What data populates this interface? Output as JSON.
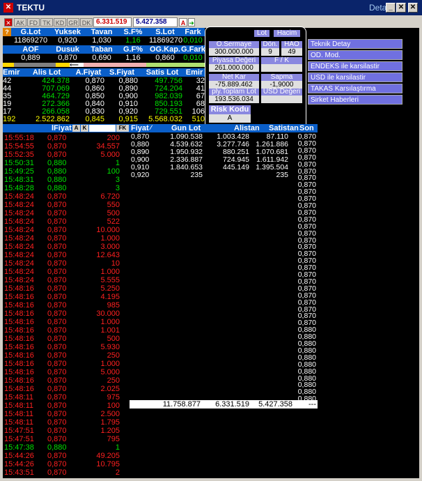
{
  "window": {
    "title": "TEKTU",
    "right_label": "Detay"
  },
  "toolbar": {
    "buttons": [
      "AK",
      "FD",
      "TK",
      "KD",
      "GR",
      "DK"
    ],
    "value1": "6.331.519",
    "value2": "5.427.358",
    "a_label": "A"
  },
  "stats": {
    "row1_headers": [
      "G.Lot",
      "Yuksek",
      "Tavan",
      "S.F%",
      "S.Lot",
      "Fark"
    ],
    "row1_values": [
      "11869270",
      "0,920",
      "1,030",
      "1,16",
      "11869270",
      "0,010"
    ],
    "row2_headers": [
      "AOF",
      "Dusuk",
      "Taban",
      "G.F%",
      "OG.Kap.",
      "G.Fark"
    ],
    "row2_values": [
      "0,889",
      "0,870",
      "0,690",
      "1,16",
      "0,860",
      "0,010"
    ]
  },
  "depth": {
    "headers": [
      "Emir",
      "Alis Lot",
      "A.Fiyat",
      "S.Fiyat",
      "Satis Lot",
      "Emir"
    ],
    "rows": [
      [
        "42",
        "424.378",
        "0,870",
        "0,880",
        "497.756",
        "32"
      ],
      [
        "44",
        "707.069",
        "0,860",
        "0,890",
        "724.204",
        "41"
      ],
      [
        "35",
        "464.729",
        "0,850",
        "0,900",
        "982.039",
        "67"
      ],
      [
        "19",
        "272.366",
        "0,840",
        "0,910",
        "850.193",
        "68"
      ],
      [
        "17",
        "266.058",
        "0,830",
        "0,920",
        "729.551",
        "106"
      ],
      [
        "192",
        "2.522.862",
        "0,845",
        "0,915",
        "5.568.032",
        "510"
      ]
    ]
  },
  "info_panel": {
    "lot_label": "Lot",
    "hacim_label": "Hacim",
    "o_sermaye_label": "O.Sermaye",
    "o_sermaye_value": "300.000.000",
    "don_label": "Dön.",
    "don_value": "9",
    "hao_label": "HAO",
    "hao_value": "49",
    "piyasa_degeri_label": "Piyasa Değeri",
    "piyasa_degeri_value": "261.000.000",
    "fk_label": "F / K",
    "net_kar_label": "Net Kar",
    "net_kar_value": "-75.889.462",
    "sapma_label": "Sapma",
    "sapma_value": "-1,9000",
    "toplam_lot_label": "ply.Toplam Lot",
    "toplam_lot_value": "193.536.034",
    "usd_label": "USD Değeri",
    "risk_label": "Risk Kodu",
    "risk_value": "A"
  },
  "menu": [
    "Teknik Detay",
    "OD. Mod.",
    "ENDEKS ile karsilastir",
    "USD ile karsilastir",
    "TAKAS Karsılaştırma",
    "Sirket Haberleri"
  ],
  "trades": {
    "header_price": "lFiyat",
    "a_btn": "A",
    "k_btn": "K",
    "fk_btn": "FK",
    "rows": [
      [
        "15:55:18",
        "0,870",
        "200",
        "r"
      ],
      [
        "15:54:55",
        "0,870",
        "34.557",
        "r"
      ],
      [
        "15:52:35",
        "0,870",
        "5.000",
        "r"
      ],
      [
        "15:50:31",
        "0,880",
        "1",
        "g"
      ],
      [
        "15:49:25",
        "0,880",
        "100",
        "g"
      ],
      [
        "15:48:31",
        "0,880",
        "3",
        "g"
      ],
      [
        "15:48:28",
        "0,880",
        "3",
        "g"
      ],
      [
        "15:48:24",
        "0,870",
        "6.720",
        "r"
      ],
      [
        "15:48:24",
        "0,870",
        "550",
        "r"
      ],
      [
        "15:48:24",
        "0,870",
        "500",
        "r"
      ],
      [
        "15:48:24",
        "0,870",
        "522",
        "r"
      ],
      [
        "15:48:24",
        "0,870",
        "10.000",
        "r"
      ],
      [
        "15:48:24",
        "0,870",
        "1.000",
        "r"
      ],
      [
        "15:48:24",
        "0,870",
        "3.000",
        "r"
      ],
      [
        "15:48:24",
        "0,870",
        "12.643",
        "r"
      ],
      [
        "15:48:24",
        "0,870",
        "10",
        "r"
      ],
      [
        "15:48:24",
        "0,870",
        "1.000",
        "r"
      ],
      [
        "15:48:24",
        "0,870",
        "5.555",
        "r"
      ],
      [
        "15:48:16",
        "0,870",
        "5.250",
        "r"
      ],
      [
        "15:48:16",
        "0,870",
        "4.195",
        "r"
      ],
      [
        "15:48:16",
        "0,870",
        "985",
        "r"
      ],
      [
        "15:48:16",
        "0,870",
        "30.000",
        "r"
      ],
      [
        "15:48:16",
        "0,870",
        "1.000",
        "r"
      ],
      [
        "15:48:16",
        "0,870",
        "1.001",
        "r"
      ],
      [
        "15:48:16",
        "0,870",
        "500",
        "r"
      ],
      [
        "15:48:16",
        "0,870",
        "5.930",
        "r"
      ],
      [
        "15:48:16",
        "0,870",
        "250",
        "r"
      ],
      [
        "15:48:16",
        "0,870",
        "1.000",
        "r"
      ],
      [
        "15:48:16",
        "0,870",
        "5.000",
        "r"
      ],
      [
        "15:48:16",
        "0,870",
        "250",
        "r"
      ],
      [
        "15:48:16",
        "0,870",
        "2.025",
        "r"
      ],
      [
        "15:48:11",
        "0,870",
        "975",
        "r"
      ],
      [
        "15:48:11",
        "0,870",
        "100",
        "r"
      ],
      [
        "15:48:11",
        "0,870",
        "2.500",
        "r"
      ],
      [
        "15:48:11",
        "0,870",
        "1.795",
        "r"
      ],
      [
        "15:47:51",
        "0,870",
        "1.205",
        "r"
      ],
      [
        "15:47:51",
        "0,870",
        "795",
        "r"
      ],
      [
        "15:47:38",
        "0,880",
        "1",
        "g"
      ],
      [
        "15:44:26",
        "0,870",
        "49.205",
        "r"
      ],
      [
        "15:44:26",
        "0,870",
        "10.795",
        "r"
      ],
      [
        "15:43:51",
        "0,870",
        "2",
        "r"
      ]
    ]
  },
  "price_table": {
    "headers": [
      "Fiyat",
      "Gun Lot",
      "Alistan",
      "Satistan",
      "Son"
    ],
    "rows": [
      [
        "0,870",
        "1.090.538",
        "1.003.428",
        "87.110"
      ],
      [
        "0,880",
        "4.539.632",
        "3.277.746",
        "1.261.886"
      ],
      [
        "0,890",
        "1.950.932",
        "880.251",
        "1.070.681"
      ],
      [
        "0,900",
        "2.336.887",
        "724.945",
        "1.611.942"
      ],
      [
        "0,910",
        "1.840.653",
        "445.149",
        "1.395.504"
      ],
      [
        "0,920",
        "235",
        "",
        "235"
      ]
    ],
    "totals": [
      "11.758.877",
      "6.331.519",
      "5.427.358",
      "---"
    ]
  },
  "son_column": [
    "0,870",
    "0,870",
    "0,870",
    "0,870",
    "0,870",
    "0,870",
    "0,870",
    "0,870",
    "0,870",
    "0,870",
    "0,870",
    "0,870",
    "0,870",
    "0,870",
    "0,870",
    "0,870",
    "0,870",
    "0,870",
    "0,870",
    "0,870",
    "0,870",
    "0,870",
    "0,870",
    "0,870",
    "0,870",
    "0,870",
    "0,870",
    "0,870",
    "0,880",
    "0,880",
    "0,880",
    "0,880",
    "0,880",
    "0,880",
    "0,880",
    "0,880",
    "0,880",
    "0,880",
    "0,880"
  ]
}
